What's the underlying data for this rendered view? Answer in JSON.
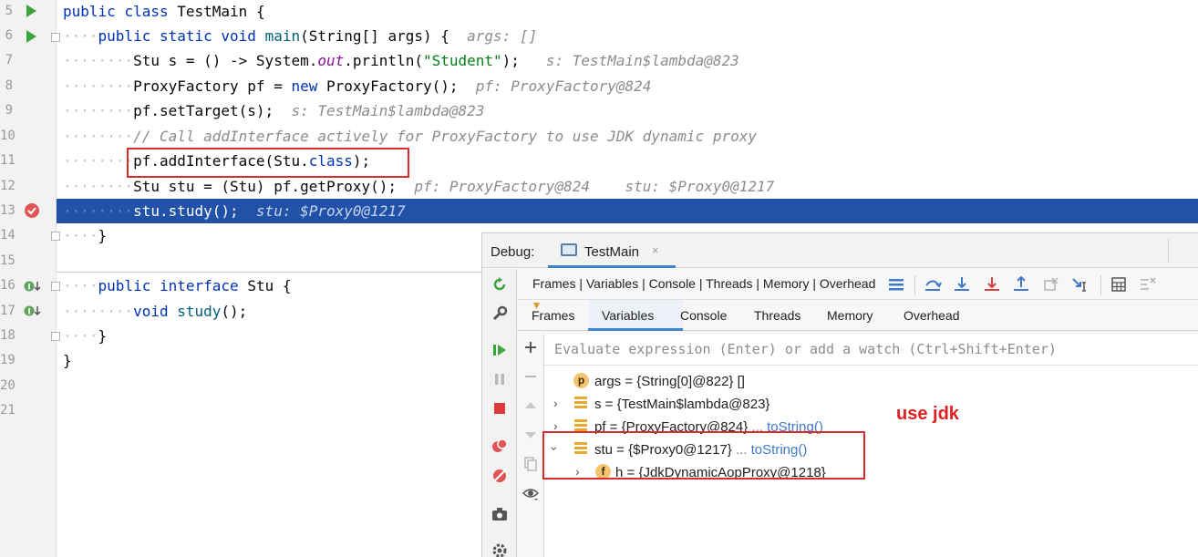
{
  "editor": {
    "line_numbers": [
      "5",
      "6",
      "7",
      "8",
      "9",
      "10",
      "11",
      "12",
      "13",
      "14",
      "15",
      "16",
      "17",
      "18",
      "19",
      "20",
      "21"
    ],
    "lines": {
      "l5": {
        "kw1": "public",
        "kw2": "class",
        "name": "TestMain",
        "brace": "{"
      },
      "l6": {
        "kw1": "public",
        "kw2": "static",
        "kw3": "void",
        "fn": "main",
        "rest": "(String[] args) {",
        "hint": "args: []"
      },
      "l7": {
        "code1": "Stu s = () -> System.",
        "static": "out",
        "code2": ".println(",
        "str": "\"Student\"",
        "code3": ");",
        "hint": "s: TestMain$lambda@823"
      },
      "l8": {
        "code1": "ProxyFactory pf = ",
        "kw": "new",
        "code2": " ProxyFactory();",
        "hint": "pf: ProxyFactory@824"
      },
      "l9": {
        "code": "pf.setTarget(s);",
        "hint": "s: TestMain$lambda@823"
      },
      "l10": {
        "comment": "// Call addInterface actively for ProxyFactory to use JDK dynamic proxy"
      },
      "l11": {
        "code1": "pf.addInterface(Stu.",
        "kw": "class",
        "code2": ");"
      },
      "l12": {
        "code": "Stu stu = (Stu) pf.getProxy();",
        "hint1": "pf: ProxyFactory@824",
        "hint2": "stu: $Proxy0@1217"
      },
      "l13": {
        "code": "stu.study();",
        "hint": "stu: $Proxy0@1217"
      },
      "l14": {
        "code": "}"
      },
      "l16": {
        "kw1": "public",
        "kw2": "interface",
        "name": "Stu",
        "brace": "{"
      },
      "l17": {
        "kw": "void",
        "fn": "study",
        "rest": "();"
      },
      "l18": {
        "code": "}"
      },
      "l19": {
        "code": "}"
      }
    }
  },
  "debug": {
    "title": "Debug:",
    "tab_label": "TestMain",
    "tab_close": "×",
    "toolbar_label": "Frames | Variables | Console | Threads | Memory | Overhead",
    "subtabs": [
      "Frames",
      "Variables",
      "Console",
      "Threads",
      "Memory",
      "Overhead"
    ],
    "active_subtab": "Variables",
    "eval_placeholder": "Evaluate expression (Enter) or add a watch (Ctrl+Shift+Enter)",
    "variables": [
      {
        "icon": "p",
        "name": "args",
        "value": "{String[0]@822} []"
      },
      {
        "name": "s",
        "value": "{TestMain$lambda@823}"
      },
      {
        "name": "pf",
        "value": "{ProxyFactory@824}",
        "more": "...",
        "link": "toString()"
      },
      {
        "name": "stu",
        "value": "{$Proxy0@1217}",
        "more": "...",
        "link": "toString()"
      },
      {
        "icon": "f",
        "name": "h",
        "value": "{JdkDynamicAopProxy@1218}"
      }
    ]
  },
  "annotation": "use jdk",
  "colors": {
    "execution_line": "#2152a8",
    "highlight_box": "#d92b2b",
    "annotation": "#e02020",
    "run_icon": "#3fa33f",
    "tab_underline": "#4083c9"
  }
}
